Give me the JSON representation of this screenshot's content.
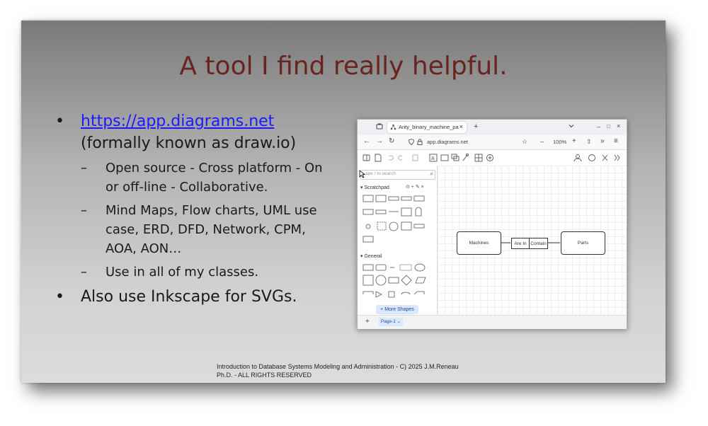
{
  "slide": {
    "title": "A tool I find really helpful.",
    "bullet_mark": "•",
    "dash_mark": "–",
    "link_text": "https://app.diagrams.net",
    "link_suffix": "(formally known as draw.io)",
    "sub_items": [
      "Open source - Cross platform - On or off-line - Collaborative.",
      "Mind Maps, Flow charts, UML use case, ERD, DFD, Network, CPM, AOA, AON…",
      "Use in all of my classes."
    ],
    "bullet2": "Also use Inkscape for SVGs.",
    "footer_line1": "Introduction to Database Systems Modeling and Administration - C) 2025 J.M.Reneau",
    "footer_line2": "Ph.D. - ALL RIGHTS RESERVED"
  },
  "browser": {
    "tab_title": "Arity_binary_machine_pa",
    "tab_close": "×",
    "new_tab": "+",
    "url": "app.diagrams.net",
    "zoom": "100%",
    "window_controls": [
      "–",
      "□",
      "×"
    ]
  },
  "drawio": {
    "search_placeholder": "ape / to search",
    "scratchpad_label": "Scratchpad",
    "general_label": "General",
    "more_shapes": "+ More Shapes",
    "page_tab": "Page-1",
    "add_page": "+",
    "nodes": {
      "machines": "Machines",
      "are_in": "Are In",
      "contain": "Contain",
      "parts": "Parts"
    }
  },
  "icons": [
    "tab-overview-icon",
    "diagram-favicon",
    "chevron-down-icon",
    "back-icon",
    "forward-icon",
    "reload-icon",
    "shield-icon",
    "lock-icon",
    "star-icon",
    "zoom-out-icon",
    "zoom-in-icon",
    "extensions-icon",
    "overflow-icon",
    "menu-icon",
    "search-icon",
    "cursor-icon"
  ]
}
